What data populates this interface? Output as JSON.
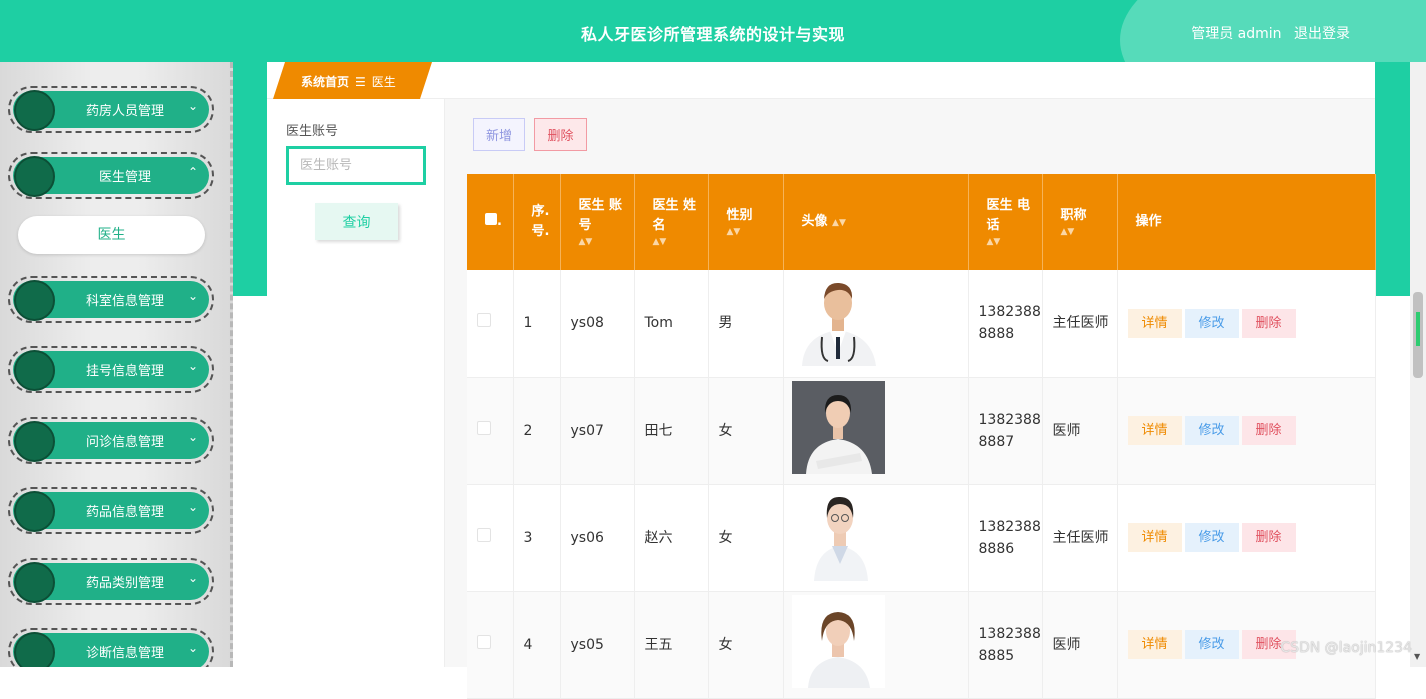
{
  "header": {
    "title": "私人牙医诊所管理系统的设计与实现",
    "user_label": "管理员 admin",
    "logout": "退出登录"
  },
  "sidebar": {
    "items": [
      {
        "label": "药房人员管理",
        "chevron": "⌄"
      },
      {
        "label": "医生管理",
        "chevron": "⌃"
      },
      {
        "label": "科室信息管理",
        "chevron": "⌄"
      },
      {
        "label": "挂号信息管理",
        "chevron": "⌄"
      },
      {
        "label": "问诊信息管理",
        "chevron": "⌄"
      },
      {
        "label": "药品信息管理",
        "chevron": "⌄"
      },
      {
        "label": "药品类别管理",
        "chevron": "⌄"
      },
      {
        "label": "诊断信息管理",
        "chevron": "⌄"
      }
    ],
    "sub_item": "医生"
  },
  "breadcrumb": {
    "home": "系统首页",
    "separator": "☰",
    "current": "医生"
  },
  "search": {
    "label": "医生账号",
    "placeholder": "医生账号",
    "button": "查询"
  },
  "toolbar": {
    "add_label": "新增",
    "delete_label": "删除"
  },
  "table": {
    "headers": {
      "seq": "序. 号.",
      "account": "医生 账号",
      "name": "医生 姓名",
      "gender": "性别",
      "avatar": "头像",
      "phone": "医生 电话",
      "title": "职称",
      "ops": "操作"
    },
    "sort_icon": "▲▼",
    "rows": [
      {
        "seq": "1",
        "account": "ys08",
        "name": "Tom",
        "gender": "男",
        "phone": "13823888888",
        "title": "主任医师"
      },
      {
        "seq": "2",
        "account": "ys07",
        "name": "田七",
        "gender": "女",
        "phone": "13823888887",
        "title": "医师"
      },
      {
        "seq": "3",
        "account": "ys06",
        "name": "赵六",
        "gender": "女",
        "phone": "13823888886",
        "title": "主任医师"
      },
      {
        "seq": "4",
        "account": "ys05",
        "name": "王五",
        "gender": "女",
        "phone": "13823888885",
        "title": "医师"
      }
    ],
    "ops": {
      "detail": "详情",
      "edit": "修改",
      "remove": "删除"
    }
  },
  "watermark": "CSDN @laojin1234",
  "colors": {
    "primary": "#1ecfa3",
    "header_orange": "#ef8a00",
    "sidebar_green": "#20b088"
  }
}
